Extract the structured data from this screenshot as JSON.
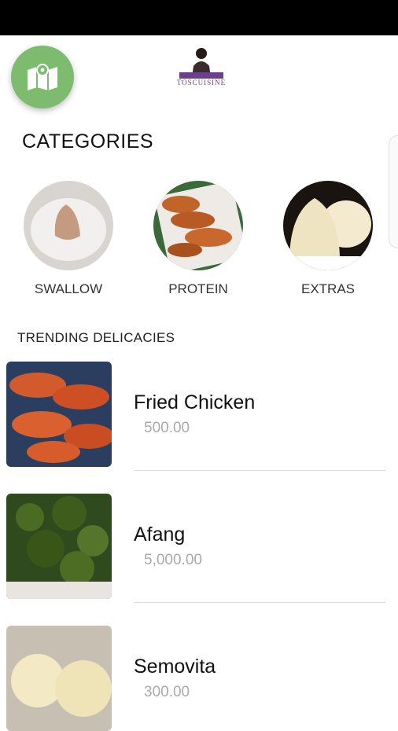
{
  "header": {
    "map_icon": "map-icon",
    "logo_text": "TOSCUISINE"
  },
  "categories": {
    "title": "CATEGORIES",
    "items": [
      {
        "label": "SWALLOW",
        "image": "swallow-image"
      },
      {
        "label": "PROTEIN",
        "image": "protein-image"
      },
      {
        "label": "EXTRAS",
        "image": "extras-image"
      }
    ]
  },
  "trending": {
    "title": "TRENDING DELICACIES",
    "items": [
      {
        "name": "Fried Chicken",
        "price": "500.00"
      },
      {
        "name": "Afang",
        "price": "5,000.00"
      },
      {
        "name": "Semovita",
        "price": "300.00"
      }
    ]
  },
  "colors": {
    "accent_green": "#7dbb6e",
    "status_bar": "#000000",
    "price_gray": "#aaaaaa"
  }
}
